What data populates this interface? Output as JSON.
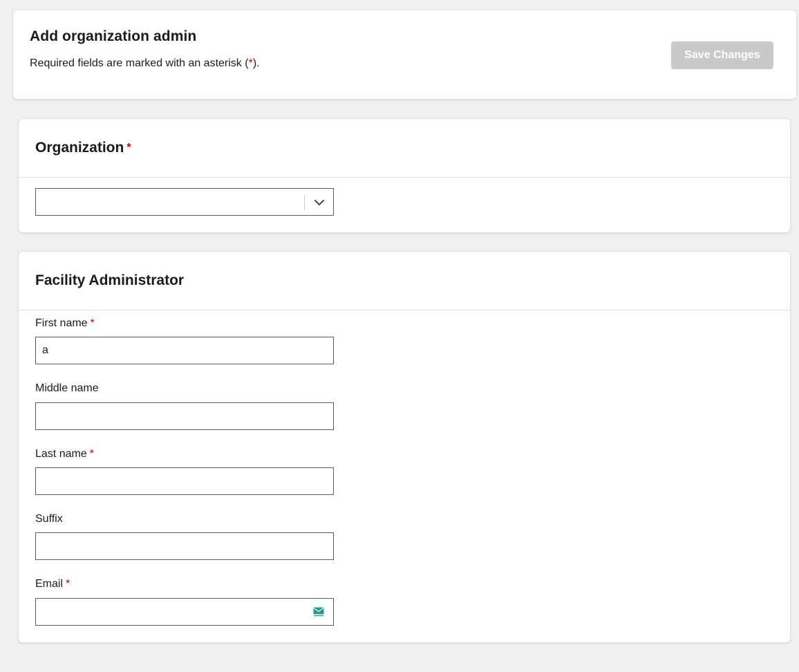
{
  "header": {
    "title": "Add organization admin",
    "required_note_prefix": "Required fields are marked with an asterisk (",
    "required_note_asterisk": "*",
    "required_note_suffix": ").",
    "save_label": "Save Changes"
  },
  "organization": {
    "title": "Organization",
    "required_marker": "*",
    "select_value": ""
  },
  "facility": {
    "title": "Facility Administrator",
    "fields": {
      "first_name": {
        "label": "First name",
        "required_marker": "*",
        "value": "a"
      },
      "middle_name": {
        "label": "Middle name",
        "value": ""
      },
      "last_name": {
        "label": "Last name",
        "required_marker": "*",
        "value": ""
      },
      "suffix": {
        "label": "Suffix",
        "value": ""
      },
      "email": {
        "label": "Email",
        "required_marker": "*",
        "value": ""
      }
    }
  },
  "icons": {
    "select_chevron": "chevron-down-icon",
    "email_field": "envelope-icon"
  },
  "colors": {
    "background": "#f0f0f0",
    "required_asterisk": "#b50909",
    "save_button_disabled": "#c9c9c9",
    "email_icon": "#1f9e89"
  }
}
